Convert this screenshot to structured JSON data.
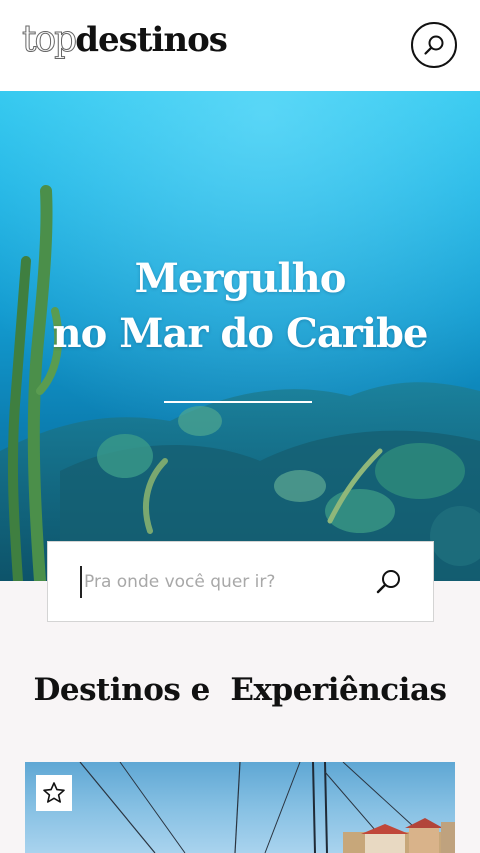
{
  "header": {
    "logo_light": "top",
    "logo_bold": "destinos",
    "search_icon": "search-icon"
  },
  "hero": {
    "title_line1": "Mergulho",
    "title_line2": "no Mar do Caribe",
    "background": "underwater-coral-reef-photo"
  },
  "search": {
    "placeholder": "Pra onde você quer ir?",
    "icon": "search-icon"
  },
  "section": {
    "title": "Destinos e  Experiências"
  },
  "card": {
    "favorite_icon": "star-icon",
    "image": "sailboat-harbor-photo"
  },
  "colors": {
    "accent": "#111111",
    "hero_top": "#2dc6ee",
    "hero_bottom": "#0b6a8f",
    "page_bg": "#f8f5f6"
  }
}
